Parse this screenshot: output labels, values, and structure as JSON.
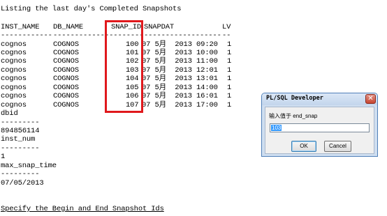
{
  "console": {
    "listing_title": "Listing the last day's Completed Snapshots",
    "headers": {
      "inst_name": "INST_NAME",
      "db_name": "DB_NAME",
      "snap_id": "SNAP_ID",
      "snapdat": "SNAPDAT",
      "lvl": "LV"
    },
    "header_rule": {
      "inst_name": "------------",
      "db_name": "-------------",
      "snap_id": "---------",
      "snapdat": "------------------",
      "lvl": "--"
    },
    "rows": [
      {
        "inst": "cognos",
        "db": "COGNOS",
        "snap": "100",
        "date": "07 5月  2013 09:20",
        "lvl": "1"
      },
      {
        "inst": "cognos",
        "db": "COGNOS",
        "snap": "101",
        "date": "07 5月  2013 10:00",
        "lvl": "1"
      },
      {
        "inst": "cognos",
        "db": "COGNOS",
        "snap": "102",
        "date": "07 5月  2013 11:00",
        "lvl": "1"
      },
      {
        "inst": "cognos",
        "db": "COGNOS",
        "snap": "103",
        "date": "07 5月  2013 12:01",
        "lvl": "1"
      },
      {
        "inst": "cognos",
        "db": "COGNOS",
        "snap": "104",
        "date": "07 5月  2013 13:01",
        "lvl": "1"
      },
      {
        "inst": "cognos",
        "db": "COGNOS",
        "snap": "105",
        "date": "07 5月  2013 14:00",
        "lvl": "1"
      },
      {
        "inst": "cognos",
        "db": "COGNOS",
        "snap": "106",
        "date": "07 5月  2013 16:01",
        "lvl": "1"
      },
      {
        "inst": "cognos",
        "db": "COGNOS",
        "snap": "107",
        "date": "07 5月  2013 17:00",
        "lvl": "1"
      }
    ],
    "dbid_label": "dbid",
    "dbid_rule": "---------",
    "dbid_value": "894856114",
    "inst_num_label": "inst_num",
    "inst_num_rule": "---------",
    "inst_num_value": "1",
    "max_snap_label": "max_snap_time",
    "max_snap_rule": "---------",
    "max_snap_value": "07/05/2013",
    "specify_line": "Specify the Begin and End Snapshot Ids"
  },
  "highlight_color": "#e0181c",
  "dialog": {
    "title": "PL/SQL Developer",
    "prompt": "输入值于 end_snap",
    "input_value": "103",
    "ok_label": "OK",
    "cancel_label": "Cancel",
    "close_icon": "close-icon"
  }
}
